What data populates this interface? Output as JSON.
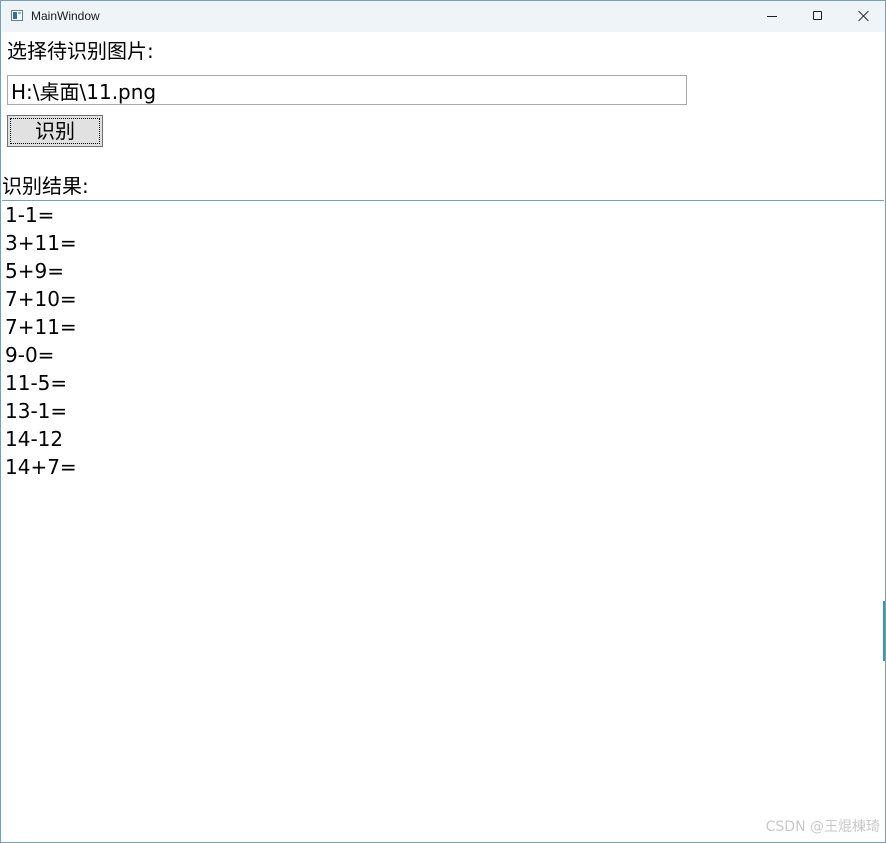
{
  "window": {
    "title": "MainWindow",
    "icon": "app-window-icon",
    "controls": {
      "minimize_icon": "minimize-icon",
      "maximize_icon": "maximize-icon",
      "close_icon": "close-icon"
    }
  },
  "form": {
    "select_label": "选择待识别图片:",
    "path_value": "H:\\桌面\\11.png",
    "recognize_button": "识别",
    "result_label": "识别结果:"
  },
  "results": [
    "1-1=",
    "3+11=",
    "5+9=",
    "7+10=",
    "7+11=",
    "9-0=",
    "11-5=",
    "13-1=",
    "14-12",
    "14+7="
  ],
  "watermark": "CSDN @王焜棟琦",
  "colors": {
    "titlebar": "#eef4f8",
    "border": "#7a9fb3",
    "button_face": "#e1e1e1"
  }
}
